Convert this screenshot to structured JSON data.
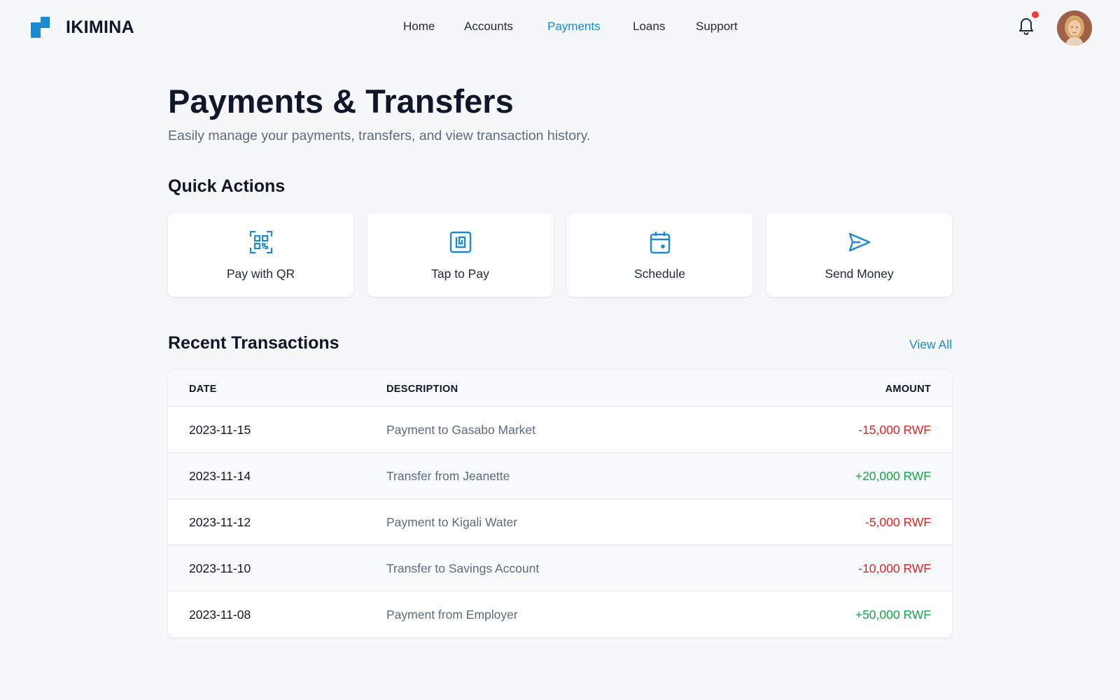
{
  "header": {
    "brand": "IKIMINA",
    "nav": [
      {
        "label": "Home",
        "active": false
      },
      {
        "label": "Accounts",
        "active": false
      },
      {
        "label": "Payments",
        "active": true
      },
      {
        "label": "Loans",
        "active": false
      },
      {
        "label": "Support",
        "active": false
      }
    ],
    "has_notification": true,
    "accent_color": "#1b8ad0"
  },
  "page": {
    "title": "Payments & Transfers",
    "subtitle": "Easily manage your payments, transfers, and view transaction history."
  },
  "quick_actions": {
    "title": "Quick Actions",
    "items": [
      {
        "label": "Pay with QR",
        "icon": "qr-code-icon"
      },
      {
        "label": "Tap to Pay",
        "icon": "nfc-icon"
      },
      {
        "label": "Schedule",
        "icon": "calendar-icon"
      },
      {
        "label": "Send Money",
        "icon": "send-icon"
      }
    ]
  },
  "transactions": {
    "title": "Recent Transactions",
    "view_all": "View All",
    "columns": [
      "DATE",
      "DESCRIPTION",
      "AMOUNT"
    ],
    "rows": [
      {
        "date": "2023-11-15",
        "description": "Payment to Gasabo Market",
        "amount": "-15,000 RWF",
        "type": "debit"
      },
      {
        "date": "2023-11-14",
        "description": "Transfer from Jeanette",
        "amount": "+20,000 RWF",
        "type": "credit"
      },
      {
        "date": "2023-11-12",
        "description": "Payment to Kigali Water",
        "amount": "-5,000 RWF",
        "type": "debit"
      },
      {
        "date": "2023-11-10",
        "description": "Transfer to Savings Account",
        "amount": "-10,000 RWF",
        "type": "debit"
      },
      {
        "date": "2023-11-08",
        "description": "Payment from Employer",
        "amount": "+50,000 RWF",
        "type": "credit"
      }
    ],
    "colors": {
      "debit": "#dc2626",
      "credit": "#16a34a"
    }
  }
}
